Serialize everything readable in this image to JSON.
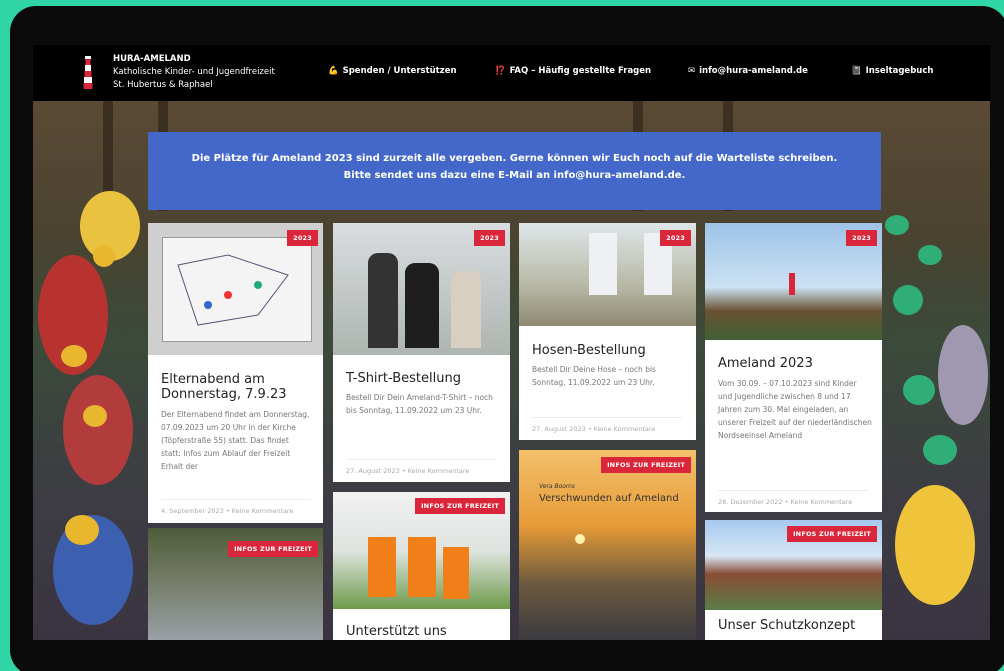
{
  "header": {
    "site_name": "HURA-AMELAND",
    "site_sub1": "Katholische Kinder- und Jugendfreizeit",
    "site_sub2": "St. Hubertus & Raphael",
    "nav": [
      {
        "icon": "💪",
        "label": "Spenden / Unterstützen"
      },
      {
        "icon": "⁉️",
        "label": "FAQ – Häufig gestellte Fragen"
      },
      {
        "icon": "✉",
        "label": "info@hura-ameland.de"
      },
      {
        "icon": "📓",
        "label": "Inseltagebuch"
      }
    ]
  },
  "banner": "Die Plätze für Ameland 2023 sind zurzeit alle vergeben. Gerne können wir Euch noch auf die Warteliste schreiben. Bitte sendet uns dazu eine E-Mail an info@hura-ameland.de.",
  "cards": [
    {
      "badge": "2023",
      "title": "Elternabend am Donnerstag, 7.9.23",
      "excerpt": "Der Elternabend findet am Donnerstag, 07.09.2023 um 20 Uhr in der Kirche (Töpferstraße 55) statt. Das findet statt: Infos zum Ablauf der Freizeit Erhalt der",
      "meta": "4. September 2023 • Keine Kommentare"
    },
    {
      "badge": "2023",
      "title": "T-Shirt-Bestellung",
      "excerpt": "Bestell Dir Dein Ameland-T-Shirt – noch bis Sonntag, 11.09.2022 um 23 Uhr.",
      "meta": "27. August 2023 • Keine Kommentare"
    },
    {
      "badge": "2023",
      "title": "Hosen-Bestellung",
      "excerpt": "Bestell Dir Deine Hose – noch bis Sonntag, 11.09.2022 um 23 Uhr.",
      "meta": "27. August 2023 • Keine Kommentare"
    },
    {
      "badge": "2023",
      "title": "Ameland 2023",
      "excerpt": "Vom 30.09. – 07.10.2023 sind Kinder und Jugendliche zwischen 8 und 17 Jahren zum 30. Mal eingeladen, an unserer Freizeit auf der niederländischen Nordseeinsel Ameland",
      "meta": "28. Dezember 2022 • Keine Kommentare"
    },
    {
      "badge": "INFOS ZUR FREIZEIT",
      "title": "",
      "excerpt": "",
      "meta": ""
    },
    {
      "badge": "INFOS ZUR FREIZEIT",
      "title": "Unterstützt uns",
      "excerpt": "",
      "meta": ""
    },
    {
      "badge": "INFOS ZUR FREIZEIT",
      "title": "",
      "excerpt": "",
      "meta": "",
      "img_author": "Vera Booms",
      "img_title": "Verschwunden auf Ameland"
    },
    {
      "badge": "INFOS ZUR FREIZEIT",
      "title": "Unser Schutzkonzept",
      "excerpt": "",
      "meta": ""
    }
  ],
  "colors": {
    "accent_red": "#d9263b",
    "banner_blue": "#4468c9",
    "outer_green": "#2fd5a4"
  }
}
